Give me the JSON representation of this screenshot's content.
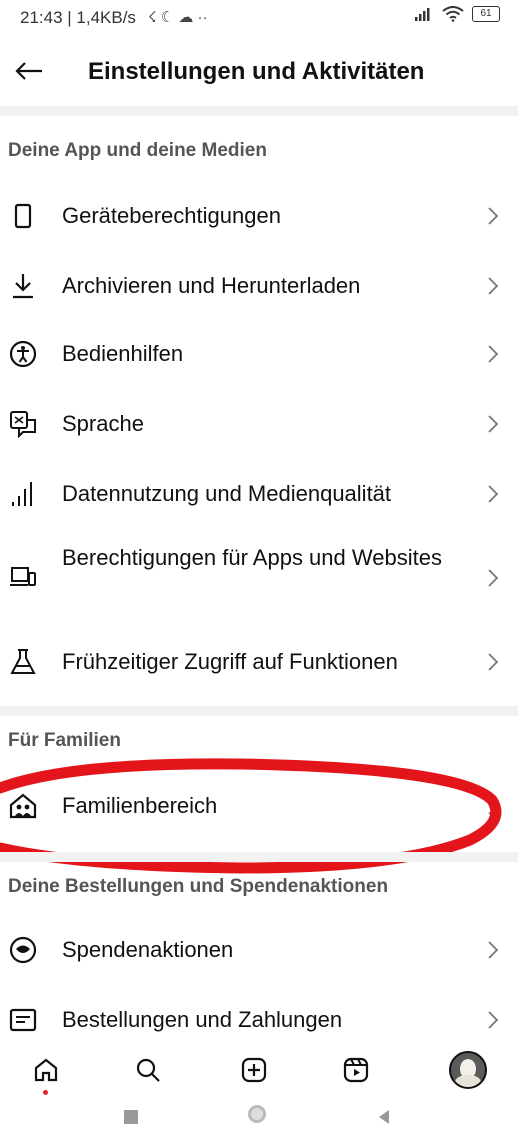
{
  "status": {
    "left_text": "21:43 | 1,4KB/s",
    "battery": "61"
  },
  "header": {
    "title": "Einstellungen und Aktivitäten"
  },
  "sections": {
    "app_media": {
      "title": "Deine App und deine Medien",
      "items": [
        {
          "label": "Geräteberechtigungen",
          "icon": "phone-icon"
        },
        {
          "label": "Archivieren und Herunterladen",
          "icon": "download-icon"
        },
        {
          "label": "Bedienhilfen",
          "icon": "accessibility-icon"
        },
        {
          "label": "Sprache",
          "icon": "translate-icon"
        },
        {
          "label": "Datennutzung und Medienqualität",
          "icon": "signal-bars-icon"
        },
        {
          "label": "Berechtigungen für Apps und Websites",
          "icon": "devices-icon"
        },
        {
          "label": "Frühzeitiger Zugriff auf Funktionen",
          "icon": "flask-icon"
        }
      ]
    },
    "families": {
      "title": "Für Familien",
      "items": [
        {
          "label": "Familienbereich",
          "icon": "family-home-icon"
        }
      ]
    },
    "orders": {
      "title": "Deine Bestellungen und Spendenaktionen",
      "items": [
        {
          "label": "Spendenaktionen",
          "icon": "fundraiser-icon"
        },
        {
          "label": "Bestellungen und Zahlungen",
          "icon": "orders-icon"
        }
      ]
    }
  },
  "annotation": {
    "color": "#e4141b"
  },
  "bottom_nav": [
    "home-icon",
    "search-icon",
    "create-icon",
    "reels-icon",
    "profile-avatar"
  ]
}
